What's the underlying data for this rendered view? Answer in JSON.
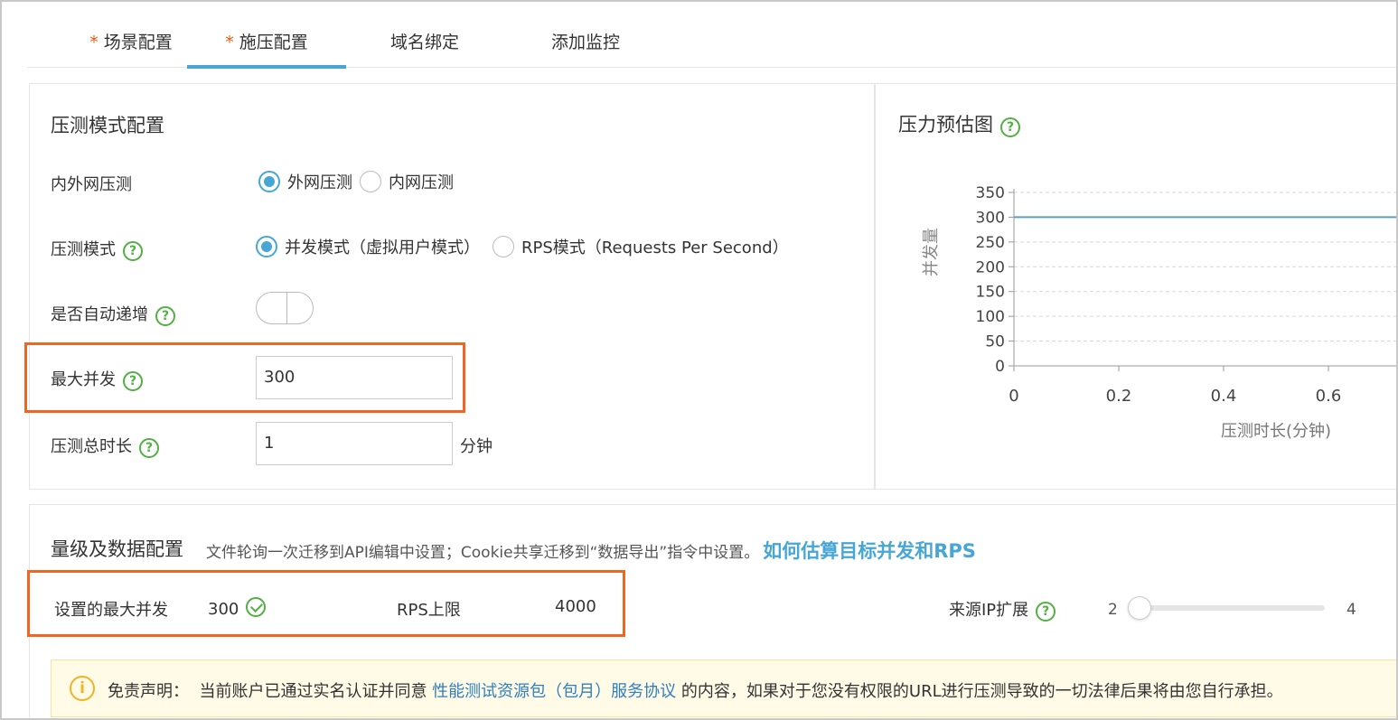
{
  "tabs": [
    {
      "label": "场景配置",
      "required": true,
      "active": false
    },
    {
      "label": "施压配置",
      "required": true,
      "active": true
    },
    {
      "label": "域名绑定",
      "required": false,
      "active": false
    },
    {
      "label": "添加监控",
      "required": false,
      "active": false
    }
  ],
  "required_mark": "*",
  "mode_config": {
    "title": "压测模式配置",
    "network": {
      "label": "内外网压测",
      "options": [
        {
          "label": "外网压测",
          "checked": true
        },
        {
          "label": "内网压测",
          "checked": false
        }
      ]
    },
    "mode": {
      "label": "压测模式",
      "options": [
        {
          "label": "并发模式（虚拟用户模式）",
          "checked": true
        },
        {
          "label": "RPS模式（Requests Per Second）",
          "checked": false
        }
      ]
    },
    "auto_increase": {
      "label": "是否自动递增",
      "enabled": false
    },
    "max_concurrency": {
      "label": "最大并发",
      "value": "300"
    },
    "duration": {
      "label": "压测总时长",
      "value": "1",
      "unit": "分钟"
    }
  },
  "help_glyph": "?",
  "chart_panel": {
    "title": "压力预估图"
  },
  "chart_data": {
    "type": "line",
    "xlabel": "压测时长(分钟)",
    "ylabel": "并发量",
    "x_ticks": [
      "0",
      "0.2",
      "0.4",
      "0.6"
    ],
    "y_ticks": [
      "0",
      "50",
      "100",
      "150",
      "200",
      "250",
      "300",
      "350"
    ],
    "ylim": [
      0,
      350
    ],
    "xlim": [
      0,
      0.74
    ],
    "series": [
      {
        "x": [
          0,
          0.74
        ],
        "values": [
          300,
          300
        ]
      }
    ],
    "grid": true
  },
  "volume_config": {
    "title": "量级及数据配置",
    "note": "文件轮询一次迁移到API编辑中设置；Cookie共享迁移到“数据导出”指令中设置。",
    "link": "如何估算目标并发和RPS",
    "set_max_label": "设置的最大并发",
    "set_max_value": "300",
    "rps_limit_label": "RPS上限",
    "rps_limit_value": "4000",
    "ip_expand_label": "来源IP扩展",
    "ip_min": "2",
    "ip_max": "4",
    "ip_value_fraction": 0
  },
  "notice": {
    "icon": "i",
    "prefix": "免责声明：  当前账户已通过实名认证并同意 ",
    "link": "性能测试资源包（包月）服务协议",
    "suffix": " 的内容，如果对于您没有权限的URL进行压测导致的一切法律后果将由您自行承担。"
  },
  "colors": {
    "accent": "#46a6d6",
    "highlight": "#f16523",
    "help": "#52b043",
    "line": "#5b9ec4"
  }
}
